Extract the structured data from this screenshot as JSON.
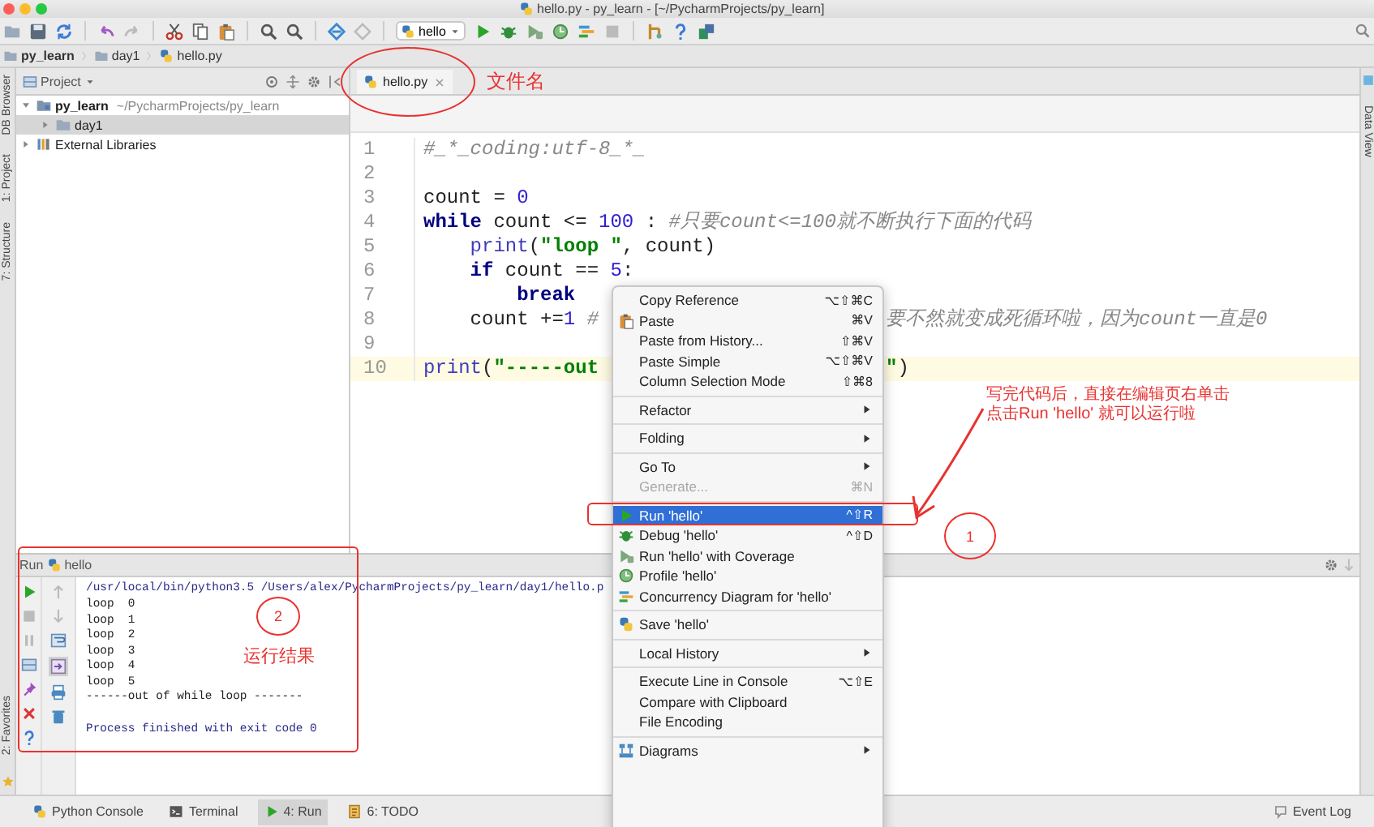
{
  "window": {
    "title": "hello.py - py_learn - [~/PycharmProjects/py_learn]"
  },
  "toolbar": {
    "run_config": "hello"
  },
  "breadcrumb": [
    {
      "label": "py_learn",
      "kind": "project"
    },
    {
      "label": "day1",
      "kind": "folder"
    },
    {
      "label": "hello.py",
      "kind": "file"
    }
  ],
  "left_stripe": {
    "top": [
      "DB Browser",
      "1: Project",
      "7: Structure"
    ],
    "bottom": [
      "2: Favorites"
    ]
  },
  "right_stripe": [
    "Data View"
  ],
  "project_panel": {
    "title": "Project",
    "tree": [
      {
        "label": "py_learn",
        "kind": "project",
        "path": "~/PycharmProjects/py_learn",
        "expanded": true,
        "selected": false,
        "children": [
          {
            "label": "day1",
            "kind": "folder",
            "expanded": false,
            "selected": true
          }
        ]
      },
      {
        "label": "External Libraries",
        "kind": "library",
        "expanded": false,
        "selected": false
      }
    ]
  },
  "editor": {
    "tabs": [
      {
        "label": "hello.py",
        "selected": true
      }
    ],
    "lines": [
      {
        "number": "1",
        "current": false,
        "tokens": [
          {
            "kind": "comment",
            "text": "#_*_coding:utf-8_*_"
          }
        ]
      },
      {
        "number": "2",
        "current": false
      },
      {
        "number": "3",
        "current": false,
        "tokens": [
          {
            "kind": "plain",
            "text": "count = "
          },
          {
            "kind": "number",
            "text": "0"
          }
        ]
      },
      {
        "number": "4",
        "current": false,
        "tokens": [
          {
            "kind": "keyword",
            "text": "while"
          },
          {
            "kind": "plain",
            "text": " count <= "
          },
          {
            "kind": "number",
            "text": "100"
          },
          {
            "kind": "plain",
            "text": " : "
          },
          {
            "kind": "comment",
            "text": "#只要count<=100就不断执行下面的代码"
          }
        ]
      },
      {
        "number": "5",
        "current": false,
        "tokens": [
          {
            "kind": "builtin",
            "text": "    print"
          },
          {
            "kind": "plain",
            "text": "("
          },
          {
            "kind": "string",
            "text": "\"loop \""
          },
          {
            "kind": "plain",
            "text": ", count)"
          }
        ]
      },
      {
        "number": "6",
        "current": false,
        "tokens": [
          {
            "kind": "keyword",
            "text": "    if"
          },
          {
            "kind": "plain",
            "text": " count == "
          },
          {
            "kind": "number",
            "text": "5"
          },
          {
            "kind": "plain",
            "text": ":"
          }
        ]
      },
      {
        "number": "7",
        "current": false,
        "tokens": [
          {
            "kind": "keyword",
            "text": "        break"
          }
        ]
      },
      {
        "number": "8",
        "current": false,
        "tokens": [
          {
            "kind": "plain",
            "text": "    count +="
          },
          {
            "kind": "number",
            "text": "1"
          },
          {
            "kind": "comment",
            "text": " #"
          }
        ],
        "tail": [
          {
            "kind": "comment",
            "text": "要不然就变成死循环啦，因为count一直是0"
          }
        ]
      },
      {
        "number": "9",
        "current": false
      },
      {
        "number": "10",
        "current": true,
        "tokens": [
          {
            "kind": "builtin",
            "text": "print"
          },
          {
            "kind": "plain",
            "text": "("
          },
          {
            "kind": "string",
            "text": "\"-----out"
          }
        ],
        "tail": [
          {
            "kind": "string",
            "text": "\""
          },
          {
            "kind": "plain",
            "text": ")"
          }
        ]
      }
    ]
  },
  "context_menu": {
    "items": [
      {
        "kind": "item",
        "label": "Copy Reference",
        "shortcut": "⌥⇧⌘C",
        "selected": false,
        "disabled": false
      },
      {
        "kind": "item",
        "label": "Paste",
        "shortcut": "⌘V",
        "selected": false,
        "disabled": false
      },
      {
        "kind": "item",
        "label": "Paste from History...",
        "shortcut": "⇧⌘V",
        "selected": false,
        "disabled": false
      },
      {
        "kind": "item",
        "label": "Paste Simple",
        "shortcut": "⌥⇧⌘V",
        "selected": false,
        "disabled": false
      },
      {
        "kind": "item",
        "label": "Column Selection Mode",
        "shortcut": "⇧⌘8",
        "selected": false,
        "disabled": false
      },
      {
        "kind": "separator"
      },
      {
        "kind": "submenu",
        "label": "Refactor",
        "selected": false,
        "disabled": false
      },
      {
        "kind": "separator"
      },
      {
        "kind": "submenu",
        "label": "Folding",
        "selected": false,
        "disabled": false
      },
      {
        "kind": "separator"
      },
      {
        "kind": "submenu",
        "label": "Go To",
        "selected": false,
        "disabled": false
      },
      {
        "kind": "item",
        "label": "Generate...",
        "shortcut": "⌘N",
        "selected": false,
        "disabled": true
      },
      {
        "kind": "separator"
      },
      {
        "kind": "item",
        "label": "Run 'hello'",
        "shortcut": "^⇧R",
        "selected": true,
        "disabled": false
      },
      {
        "kind": "item",
        "label": "Debug 'hello'",
        "shortcut": "^⇧D",
        "selected": false,
        "disabled": false
      },
      {
        "kind": "item",
        "label": "Run 'hello' with Coverage",
        "selected": false,
        "disabled": false
      },
      {
        "kind": "item",
        "label": "Profile 'hello'",
        "selected": false,
        "disabled": false
      },
      {
        "kind": "item",
        "label": "Concurrency Diagram for  'hello'",
        "selected": false,
        "disabled": false
      },
      {
        "kind": "separator"
      },
      {
        "kind": "item",
        "label": "Save 'hello'",
        "selected": false,
        "disabled": false
      },
      {
        "kind": "separator"
      },
      {
        "kind": "submenu",
        "label": "Local History",
        "selected": false,
        "disabled": false
      },
      {
        "kind": "separator"
      },
      {
        "kind": "item",
        "label": "Execute Line in Console",
        "shortcut": "⌥⇧E",
        "selected": false,
        "disabled": false
      },
      {
        "kind": "item",
        "label": "Compare with Clipboard",
        "selected": false,
        "disabled": false
      },
      {
        "kind": "item",
        "label": "File Encoding",
        "selected": false,
        "disabled": false
      },
      {
        "kind": "separator"
      },
      {
        "kind": "submenu",
        "label": "Diagrams",
        "selected": false,
        "disabled": false
      }
    ]
  },
  "run_panel": {
    "title": "Run",
    "config": "hello",
    "console": [
      {
        "kind": "command",
        "text": "/usr/local/bin/python3.5 /Users/alex/PycharmProjects/py_learn/day1/hello.p"
      },
      {
        "kind": "output",
        "text": "loop  0"
      },
      {
        "kind": "output",
        "text": "loop  1"
      },
      {
        "kind": "output",
        "text": "loop  2"
      },
      {
        "kind": "output",
        "text": "loop  3"
      },
      {
        "kind": "output",
        "text": "loop  4"
      },
      {
        "kind": "output",
        "text": "loop  5"
      },
      {
        "kind": "output",
        "text": "------out of while loop -------"
      },
      {
        "kind": "blank"
      },
      {
        "kind": "exit",
        "text": "Process finished with exit code 0"
      }
    ]
  },
  "bottom_bar": {
    "tool_windows": [
      {
        "label": "Python Console",
        "selected": false
      },
      {
        "label": "Terminal",
        "selected": false
      },
      {
        "label": "4: Run",
        "selected": true
      },
      {
        "label": "6: TODO",
        "selected": false
      }
    ],
    "event_log": "Event Log"
  },
  "annotations": {
    "file_label": "文件名",
    "instruction": [
      "写完代码后，直接在编辑页右单击",
      "点击Run  'hello' 就可以运行啦"
    ],
    "marker_1": "1",
    "marker_2": "2",
    "result_label": "运行结果"
  }
}
